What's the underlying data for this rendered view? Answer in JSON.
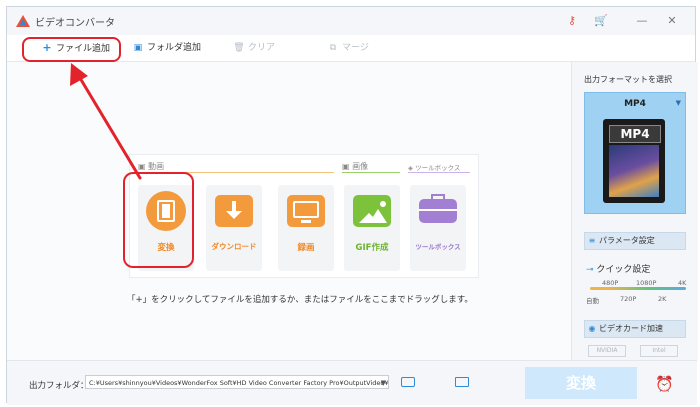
{
  "title": "ビデオコンバータ",
  "titlebar": {
    "key_icon": "key-icon",
    "cart_icon": "cart-icon",
    "minimize": "—",
    "close": "✕"
  },
  "toolbar": {
    "add_file": "ファイル追加",
    "add_folder": "フォルダ追加",
    "clear": "クリア",
    "merge": "マージ"
  },
  "sections": {
    "video": "動画",
    "image": "画像",
    "toolbox": "ツールボックス"
  },
  "tiles": [
    {
      "label": "変換",
      "icon": "film-icon",
      "color": "#f39a3d"
    },
    {
      "label": "ダウンロード",
      "icon": "download-icon",
      "color": "#f39a3d"
    },
    {
      "label": "録画",
      "icon": "screen-record-icon",
      "color": "#f39a3d"
    },
    {
      "label": "GIF作成",
      "icon": "gif-image-icon",
      "color": "#7cc23a"
    },
    {
      "label": "ツールボックス",
      "icon": "toolbox-icon",
      "color": "#a37fd4"
    }
  ],
  "hint": "「+」をクリックしてファイルを追加するか、またはファイルをここまでドラッグします。",
  "sidebar": {
    "title": "出力フォーマットを選択",
    "format_name": "MP4",
    "format_thumb": "MP4",
    "param_button": "パラメータ設定",
    "quick_title": "クイック設定",
    "quality_top": [
      "480P",
      "1080P",
      "4K"
    ],
    "quality_bottom": [
      "自動",
      "720P",
      "2K"
    ],
    "gpu_button": "ビデオカード加速",
    "hw_badges": [
      "NVIDIA",
      "Intel"
    ]
  },
  "bottom": {
    "output_label": "出力フォルダ：",
    "output_path": "C:¥Users¥shinnyou¥Videos¥WonderFox Soft¥HD Video Converter Factory Pro¥OutputVideo¥",
    "convert": "変換"
  },
  "colors": {
    "accent": "#2f8bd6",
    "annotation": "#e3232b",
    "orange": "#f39a3d"
  }
}
